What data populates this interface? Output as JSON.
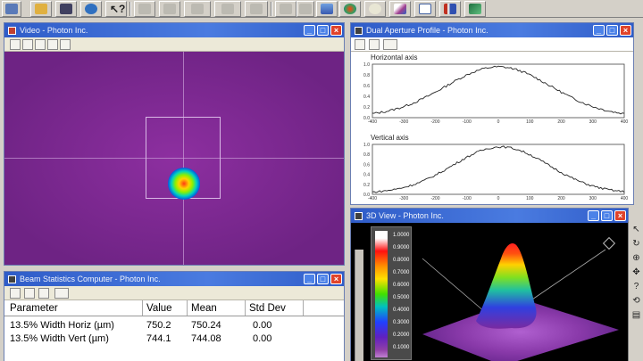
{
  "toolbar": {
    "buttons": [
      {
        "icon": "grid-icon",
        "color": "#5a7ab8"
      },
      {
        "icon": "open-folder-icon",
        "color": "#e0b040"
      },
      {
        "icon": "save-disk-icon",
        "color": "#404060"
      },
      {
        "icon": "globe-icon",
        "color": "#3070c0"
      },
      {
        "icon": "pointer-help-icon",
        "color": "#202020"
      },
      {
        "icon": "disabled-tool-icon",
        "color": "#bcbab2"
      },
      {
        "icon": "disabled-tool-icon",
        "color": "#bcbab2"
      },
      {
        "icon": "disabled-tool-icon",
        "color": "#bcbab2"
      },
      {
        "icon": "disabled-tool-icon",
        "color": "#bcbab2"
      },
      {
        "icon": "disabled-tool-icon",
        "color": "#bcbab2"
      },
      {
        "icon": "disabled-tool-icon",
        "color": "#bcbab2"
      },
      {
        "icon": "pyramid-icon",
        "color": "#3a5ab0"
      },
      {
        "icon": "beam-circle-icon",
        "color": "#208060"
      },
      {
        "icon": "light-icon",
        "color": "#c0c0a0"
      },
      {
        "icon": "profile-chart-icon",
        "color": "#a04090"
      },
      {
        "icon": "crosshair-grid-icon",
        "color": "#4060a0"
      },
      {
        "icon": "bars-icon",
        "color": "#c03020"
      },
      {
        "icon": "3d-view-icon",
        "color": "#207040"
      }
    ]
  },
  "video_window": {
    "title": "Video - Photon Inc.",
    "subtools": [
      "grid-small-icon",
      "zoom-in-icon",
      "zoom-out-icon",
      "zoom-fit-icon",
      "move-icon"
    ]
  },
  "profile_window": {
    "title": "Dual Aperture Profile - Photon Inc.",
    "subtools": [
      "options-icon",
      "cursor-icon",
      "axes-icon"
    ],
    "horizontal_label": "Horizontal axis",
    "vertical_label": "Vertical axis",
    "y_ticks": [
      "1.0",
      "0.8",
      "0.6",
      "0.4",
      "0.2",
      "0.0"
    ],
    "x_ticks": [
      "-400",
      "-300",
      "-200",
      "-100",
      "0",
      "100",
      "200",
      "300",
      "400"
    ]
  },
  "view3d_window": {
    "title": "3D View - Photon Inc.",
    "colorbar_labels": [
      "1.0000",
      "0.9000",
      "0.8000",
      "0.7000",
      "0.6000",
      "0.5000",
      "0.4000",
      "0.3000",
      "0.2000",
      "0.1000"
    ],
    "tools": [
      "arrow-pointer-icon",
      "rotate-icon",
      "zoom-tool-icon",
      "pan-hand-icon",
      "help-icon",
      "reset-icon",
      "print-icon"
    ]
  },
  "stats_window": {
    "title": "Beam Statistics Computer - Photon Inc.",
    "subtools": [
      "options-icon",
      "clear-icon",
      "close-x-icon",
      "graph-icon"
    ],
    "headers": [
      "Parameter",
      "Value",
      "Mean",
      "Std Dev"
    ],
    "rows": [
      {
        "parameter": "13.5% Width Horiz (µm)",
        "value": "750.2",
        "mean": "750.24",
        "std_dev": "0.00"
      },
      {
        "parameter": "13.5% Width Vert (µm)",
        "value": "744.1",
        "mean": "744.08",
        "std_dev": "0.00"
      }
    ]
  }
}
